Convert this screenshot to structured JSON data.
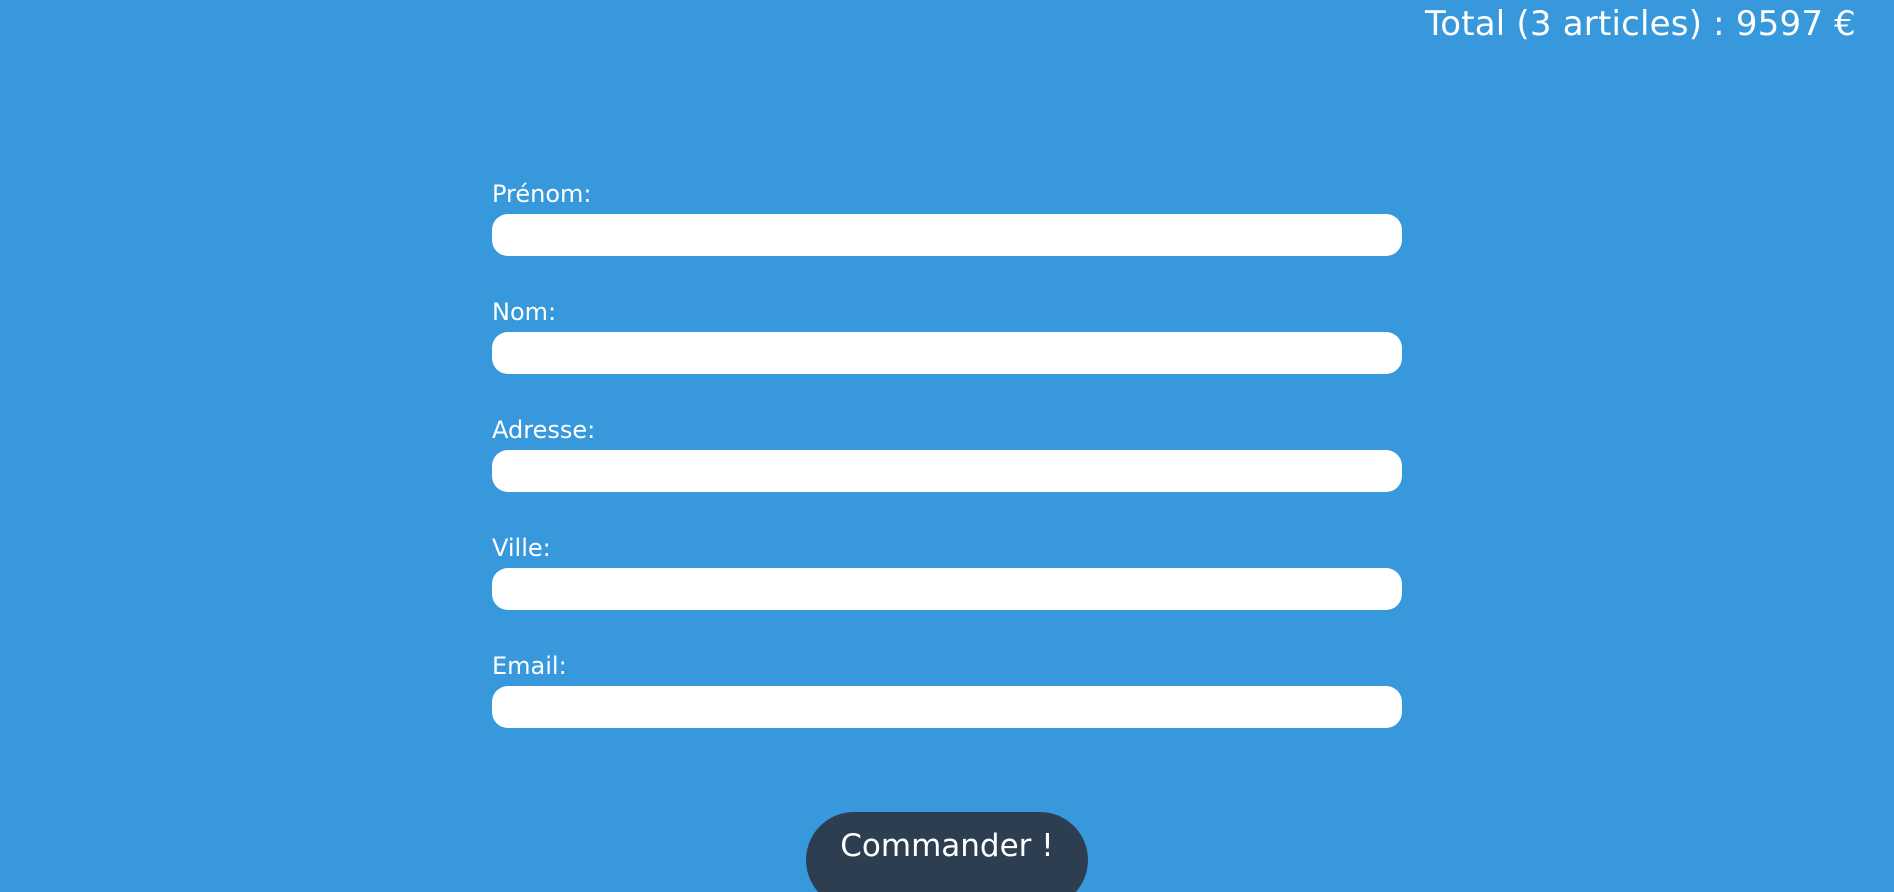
{
  "cart": {
    "total_text": "Total (3 articles) : 9597 €"
  },
  "form": {
    "fields": [
      {
        "label": "Prénom:",
        "value": "",
        "placeholder": ""
      },
      {
        "label": "Nom:",
        "value": "",
        "placeholder": ""
      },
      {
        "label": "Adresse:",
        "value": "",
        "placeholder": ""
      },
      {
        "label": "Ville:",
        "value": "",
        "placeholder": ""
      },
      {
        "label": "Email:",
        "value": "",
        "placeholder": ""
      }
    ],
    "submit_label": "Commander !"
  },
  "colors": {
    "background": "#3799dc",
    "button": "#2c3e50",
    "text": "#ffffff"
  }
}
